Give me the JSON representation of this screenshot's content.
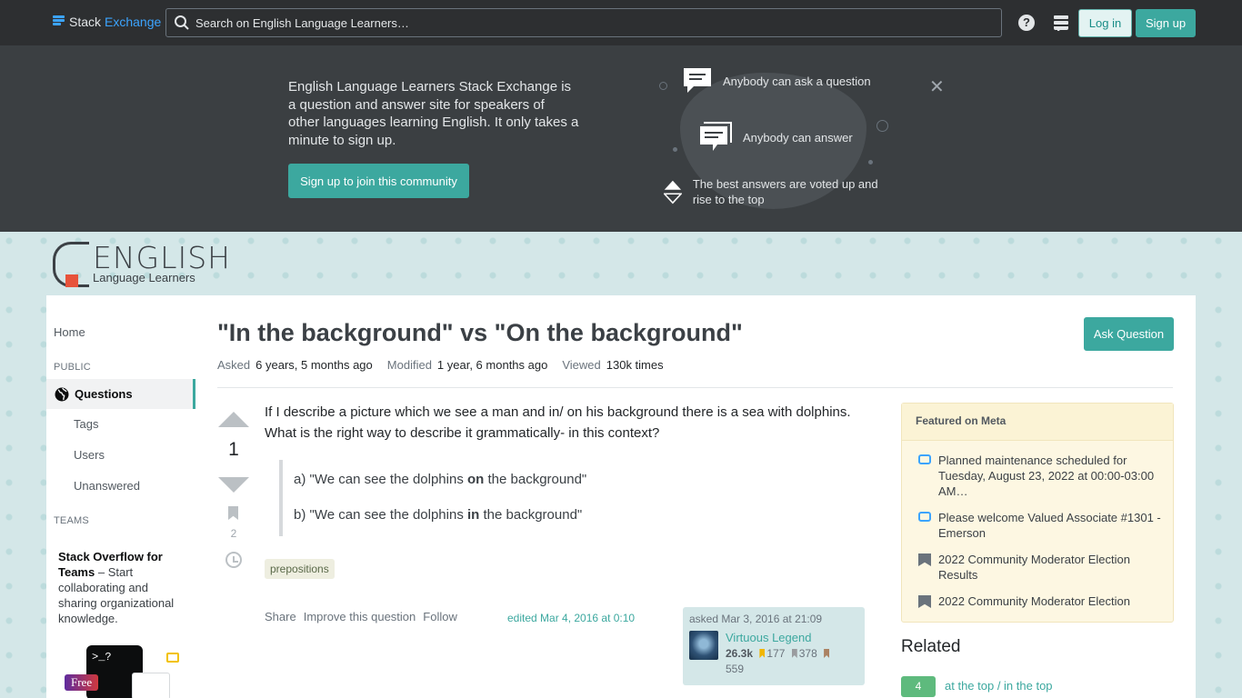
{
  "topbar": {
    "logo_stack": "Stack",
    "logo_exchange": "Exchange",
    "search_placeholder": "Search on English Language Learners…",
    "help_label": "?",
    "login_label": "Log in",
    "signup_label": "Sign up"
  },
  "hero": {
    "text": "English Language Learners Stack Exchange is a question and answer site for speakers of other languages learning English. It only takes a minute to sign up.",
    "cta": "Sign up to join this community",
    "items": [
      "Anybody can ask a question",
      "Anybody can answer",
      "The best answers are voted up and rise to the top"
    ],
    "close": "✕"
  },
  "site_logo": {
    "big": "ENGLISH",
    "small": "Language Learners"
  },
  "leftnav": {
    "home": "Home",
    "public_label": "PUBLIC",
    "questions": "Questions",
    "tags": "Tags",
    "users": "Users",
    "unanswered": "Unanswered",
    "teams_label": "TEAMS",
    "teams_title": "Stack Overflow for Teams",
    "teams_text": " – Start collaborating and sharing organizational knowledge.",
    "teams_free": "Free",
    "teams_term": ">_?"
  },
  "question": {
    "title": "\"In the background\" vs \"On the background\"",
    "ask_button": "Ask Question",
    "asked_label": "Asked",
    "asked_value": "6 years, 5 months ago",
    "modified_label": "Modified",
    "modified_value": "1 year, 6 months ago",
    "viewed_label": "Viewed",
    "viewed_value": "130k times",
    "votes": "1",
    "bookmarks": "2",
    "body": "If I describe a picture which we see a man and in/ on his background there is a sea with dolphins. What is the right way to describe it grammatically- in this context?",
    "quote_a_pre": "a) \"We can see the dolphins ",
    "quote_a_bold": "on",
    "quote_a_post": " the background\"",
    "quote_b_pre": "b) \"We can see the dolphins ",
    "quote_b_bold": "in",
    "quote_b_post": " the background\"",
    "tag": "prepositions",
    "share": "Share",
    "improve": "Improve this question",
    "follow": "Follow",
    "edited": "edited Mar 4, 2016 at 0:10",
    "asked_card": "asked Mar 3, 2016 at 21:09",
    "user_name": "Virtuous Legend",
    "user_rep": "26.3k",
    "gold": "177",
    "silver": "378",
    "bronze": "559"
  },
  "featured": {
    "title": "Featured on Meta",
    "items": [
      "Planned maintenance scheduled for Tuesday, August 23, 2022 at 00:00-03:00 AM…",
      "Please welcome Valued Associate #1301 - Emerson",
      "2022 Community Moderator Election Results",
      "2022 Community Moderator Election"
    ]
  },
  "related": {
    "title": "Related",
    "score": "4",
    "link": "at the top / in the top"
  }
}
